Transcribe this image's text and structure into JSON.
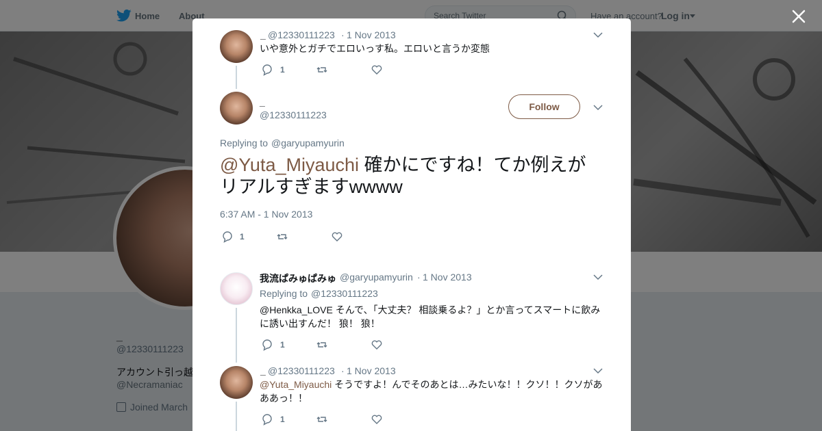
{
  "nav": {
    "home": "Home",
    "about": "About",
    "search_placeholder": "Search Twitter",
    "account_prompt": "Have an account?",
    "login": "Log in",
    "icons": [
      "twitter-bird-icon",
      "search-icon",
      "chevron-down-icon"
    ]
  },
  "profile": {
    "name": "_",
    "handle": "@12330111223",
    "bio": "アカウント引っ越",
    "link": "@Necramaniac",
    "joined": "Joined March"
  },
  "modal": {
    "tweet1": {
      "name": "_",
      "handle": "@12330111223",
      "separator": "·",
      "time": "1 Nov 2013",
      "text": "いや意外とガチでエロいっす私。エロいと言うか変態",
      "reply_count": "1"
    },
    "focused": {
      "name": "_",
      "handle": "@12330111223",
      "follow_label": "Follow",
      "replying_prefix": "Replying to",
      "replying_to": "@garyupamyurin",
      "mention": "@Yuta_Miyauchi",
      "text": " 確かにですね！てか例えがリアルすぎますwwww",
      "timestamp": "6:37 AM - 1 Nov 2013",
      "reply_count": "1"
    },
    "reply1": {
      "name": "我流ぱみゅぱみゅ",
      "handle": "@garyupamyurin",
      "separator": "·",
      "time": "1 Nov 2013",
      "replying_prefix": "Replying to",
      "replying_to": "@12330111223",
      "text": "@Henkka_LOVE そんで、「大丈夫？ 相談乗るよ？」とか言ってスマートに飲みに誘い出すんだ！ 狼！ 狼！",
      "reply_count": "1"
    },
    "reply2": {
      "name": "_",
      "handle": "@12330111223",
      "separator": "·",
      "time": "1 Nov 2013",
      "mention": "@Yuta_Miyauchi",
      "text": " そうですよ！んでそのあとは…みたいな！！クソ！！クソがあああっ！！",
      "reply_count": "1"
    }
  },
  "colors": {
    "accent": "#7d5a45",
    "twitter_blue": "#1da1f2",
    "muted": "#657786"
  }
}
